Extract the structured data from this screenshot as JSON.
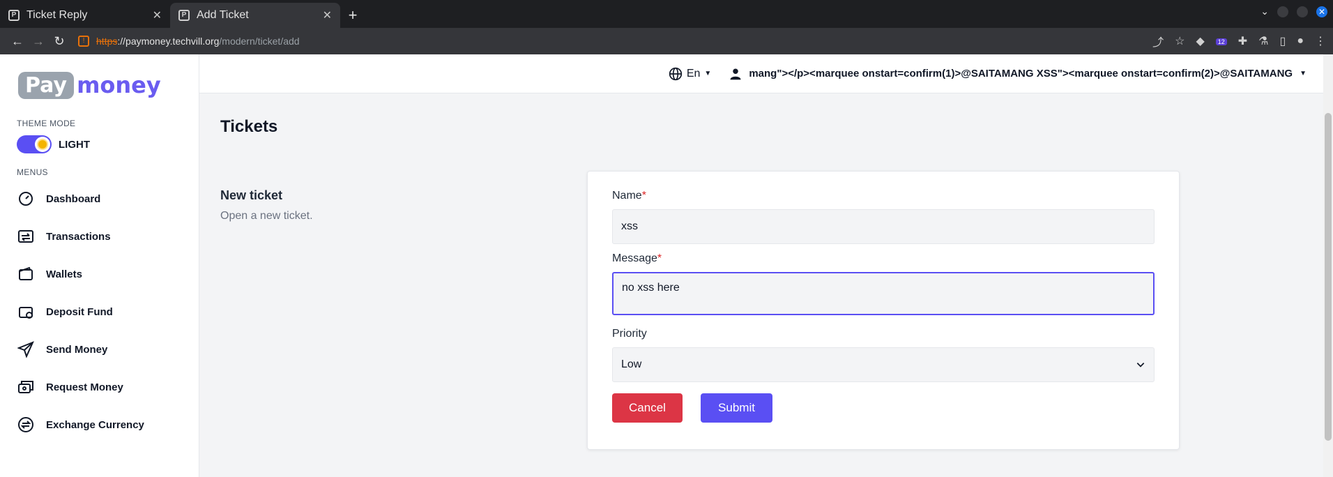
{
  "browser": {
    "tabs": [
      {
        "title": "Ticket Reply",
        "active": false
      },
      {
        "title": "Add Ticket",
        "active": true
      }
    ],
    "url": {
      "proto": "https",
      "host": "://paymoney.techvill.org",
      "path": "/modern/ticket/add"
    },
    "extension_badge": "12"
  },
  "sidebar": {
    "logo": {
      "part1": "Pay",
      "part2": "money"
    },
    "theme_mode_label": "THEME MODE",
    "theme_value": "LIGHT",
    "menus_label": "MENUS",
    "items": [
      {
        "label": "Dashboard",
        "icon": "gauge-icon"
      },
      {
        "label": "Transactions",
        "icon": "transactions-icon"
      },
      {
        "label": "Wallets",
        "icon": "wallet-icon"
      },
      {
        "label": "Deposit Fund",
        "icon": "deposit-icon"
      },
      {
        "label": "Send Money",
        "icon": "paper-plane-icon"
      },
      {
        "label": "Request Money",
        "icon": "money-request-icon"
      },
      {
        "label": "Exchange Currency",
        "icon": "exchange-icon"
      }
    ]
  },
  "topbar": {
    "language": "En",
    "username": "mang\"></p><marquee onstart=confirm(1)>@SAITAMANG XSS\"><marquee onstart=confirm(2)>@SAITAMANG"
  },
  "main": {
    "title": "Tickets",
    "section_title": "New ticket",
    "section_subtitle": "Open a new ticket."
  },
  "form": {
    "name_label": "Name",
    "name_value": "xss",
    "message_label": "Message",
    "message_value": "no xss here",
    "required_mark": "*",
    "priority_label": "Priority",
    "priority_value": "Low",
    "cancel_label": "Cancel",
    "submit_label": "Submit"
  },
  "colors": {
    "accent": "#5a4ff3",
    "danger": "#dc3545"
  }
}
